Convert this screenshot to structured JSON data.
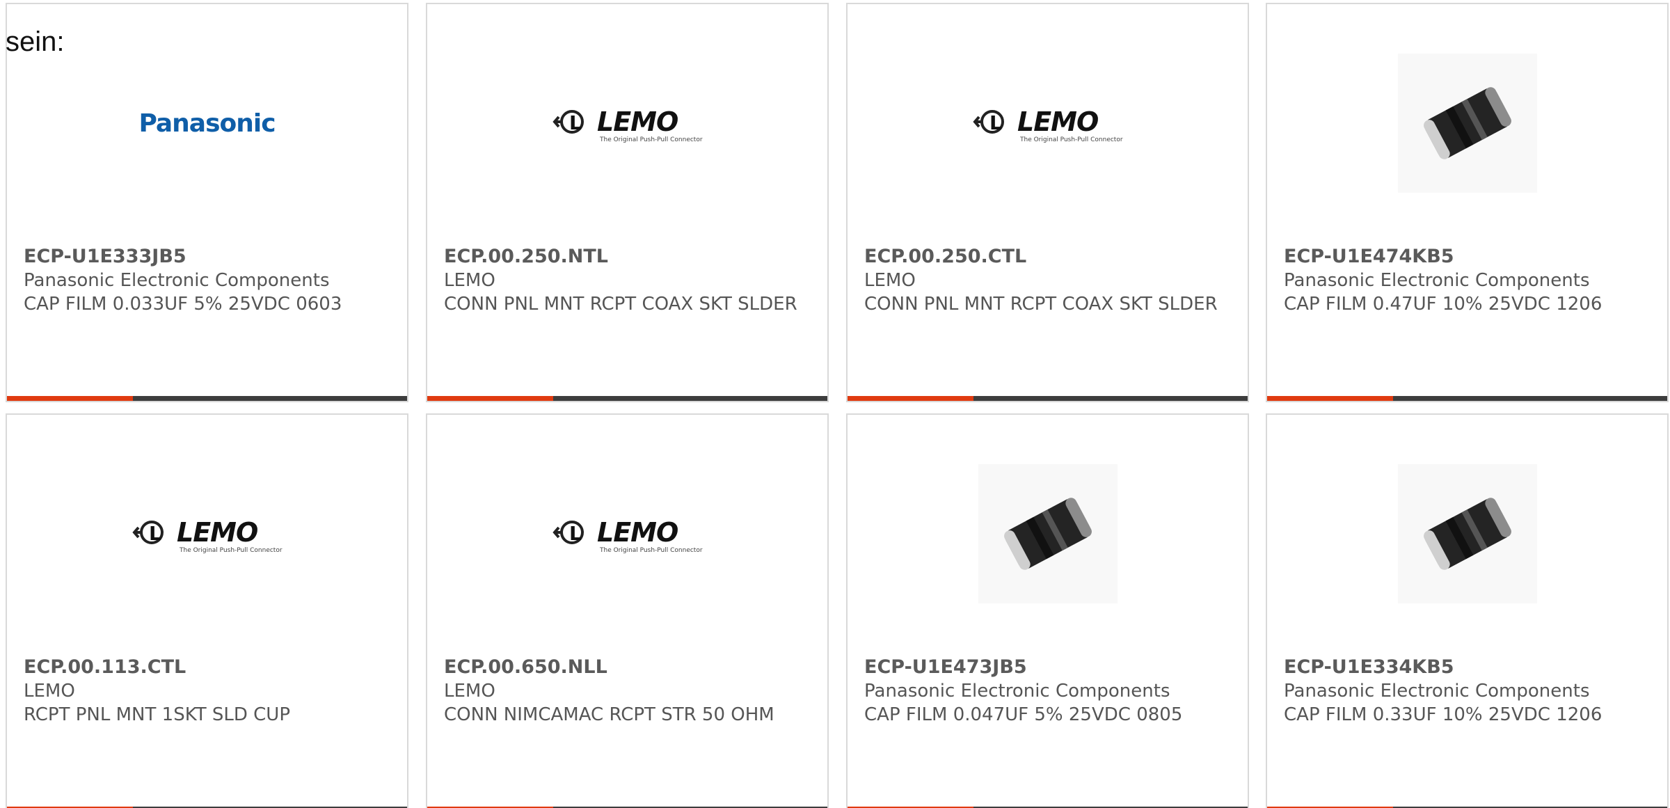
{
  "intro": {
    "text": "sein:"
  },
  "products": [
    {
      "part_number": "ECP-U1E333JB5",
      "manufacturer": "Panasonic Electronic Components",
      "description": "CAP FILM 0.033UF 5% 25VDC 0603",
      "image": "panasonic-logo",
      "logo_text": "Panasonic"
    },
    {
      "part_number": "ECP.00.250.NTL",
      "manufacturer": "LEMO",
      "description": "CONN PNL MNT RCPT COAX SKT SLDER",
      "image": "lemo-logo",
      "logo_text": "LEMO",
      "logo_tagline": "The Original Push-Pull Connector"
    },
    {
      "part_number": "ECP.00.250.CTL",
      "manufacturer": "LEMO",
      "description": "CONN PNL MNT RCPT COAX SKT SLDER",
      "image": "lemo-logo",
      "logo_text": "LEMO",
      "logo_tagline": "The Original Push-Pull Connector"
    },
    {
      "part_number": "ECP-U1E474KB5",
      "manufacturer": "Panasonic Electronic Components",
      "description": "CAP FILM 0.47UF 10% 25VDC 1206",
      "image": "chip-capacitor-image"
    },
    {
      "part_number": "ECP.00.113.CTL",
      "manufacturer": "LEMO",
      "description": "RCPT PNL MNT 1SKT SLD CUP",
      "image": "lemo-logo",
      "logo_text": "LEMO",
      "logo_tagline": "The Original Push-Pull Connector"
    },
    {
      "part_number": "ECP.00.650.NLL",
      "manufacturer": "LEMO",
      "description": "CONN NIMCAMAC RCPT STR 50 OHM",
      "image": "lemo-logo",
      "logo_text": "LEMO",
      "logo_tagline": "The Original Push-Pull Connector"
    },
    {
      "part_number": "ECP-U1E473JB5",
      "manufacturer": "Panasonic Electronic Components",
      "description": "CAP FILM 0.047UF 5% 25VDC 0805",
      "image": "chip-capacitor-image"
    },
    {
      "part_number": "ECP-U1E334KB5",
      "manufacturer": "Panasonic Electronic Components",
      "description": "CAP FILM 0.33UF 10% 25VDC 1206",
      "image": "chip-capacitor-image"
    }
  ],
  "colors": {
    "accent": "#e03a10",
    "bar": "#3d3d3d",
    "border": "#d9d9d9",
    "text": "#555555",
    "panasonic_blue": "#0f5ea8"
  }
}
